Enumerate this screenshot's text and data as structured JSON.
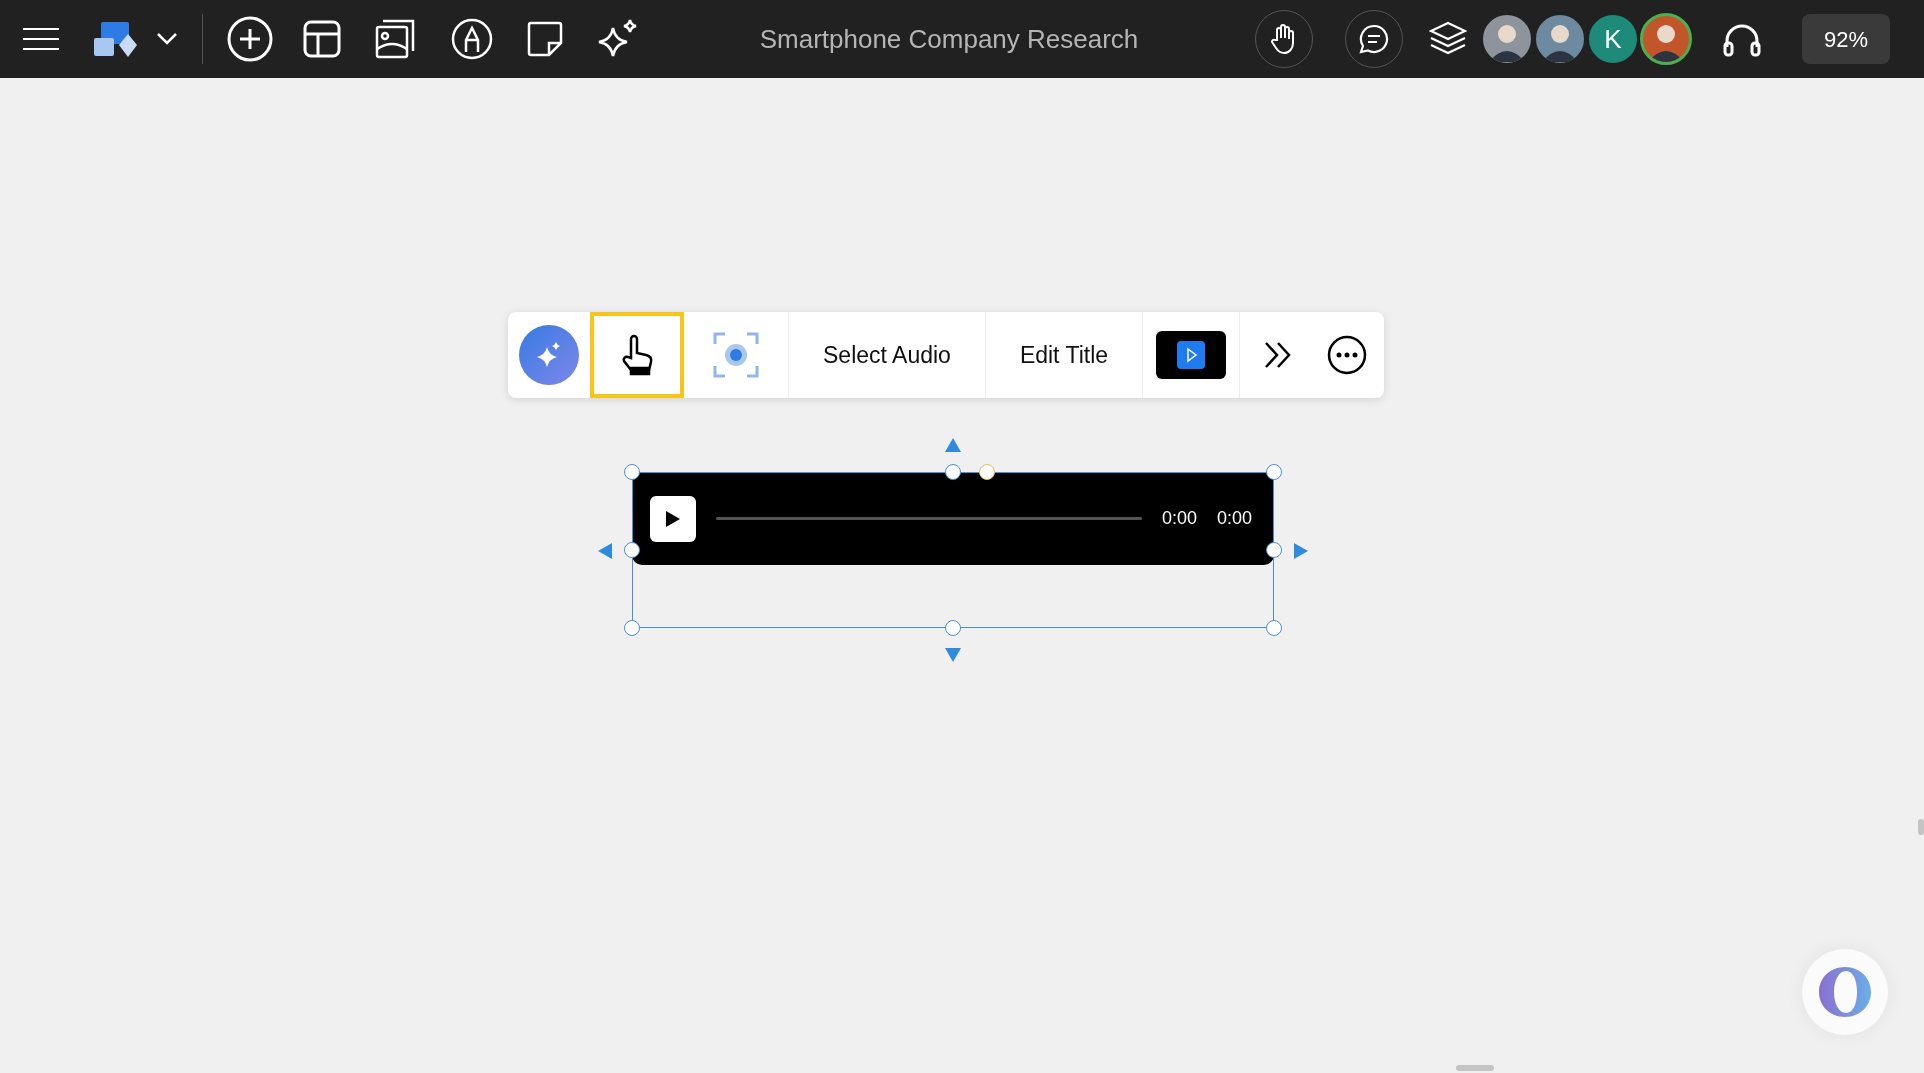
{
  "top_bar": {
    "title": "Smartphone Company Research",
    "collaborators": [
      {
        "kind": "photo",
        "highlighted": false
      },
      {
        "kind": "photo",
        "highlighted": false
      },
      {
        "kind": "initial",
        "initial": "K",
        "highlighted": false
      },
      {
        "kind": "photo",
        "highlighted": true
      }
    ],
    "zoom": "92%"
  },
  "context_toolbar": {
    "buttons": [
      {
        "kind": "ai",
        "selected": false
      },
      {
        "kind": "pointer",
        "selected": true
      },
      {
        "kind": "focus",
        "selected": false
      },
      {
        "kind": "text",
        "label": "Select Audio",
        "selected": false
      },
      {
        "kind": "text",
        "label": "Edit Title",
        "selected": false
      },
      {
        "kind": "video",
        "selected": false
      },
      {
        "kind": "forward",
        "selected": false
      },
      {
        "kind": "more",
        "selected": false
      }
    ]
  },
  "audio_player": {
    "selected": true,
    "current_time": "0:00",
    "duration": "0:00"
  }
}
